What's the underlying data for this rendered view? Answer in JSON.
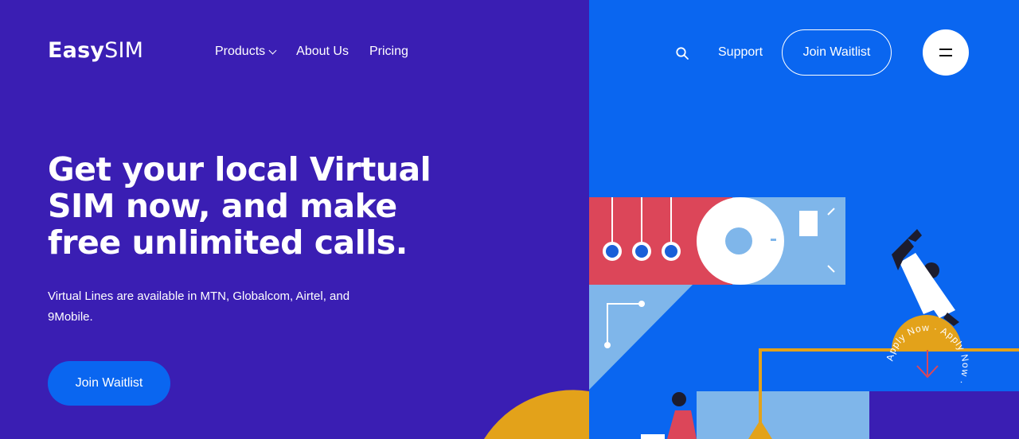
{
  "brand": {
    "name_bold": "Easy",
    "name_light": "SIM"
  },
  "nav": {
    "products": "Products",
    "about": "About Us",
    "pricing": "Pricing"
  },
  "header_right": {
    "search_icon": "search-icon",
    "support": "Support",
    "join_waitlist": "Join Waitlist",
    "menu_icon": "hamburger-menu-icon"
  },
  "hero": {
    "headline": "Get your local Virtual SIM now, and make free unlimited calls.",
    "subtext": "Virtual Lines are available in MTN, Globalcom, Airtel, and 9Mobile.",
    "cta": "Join Waitlist"
  },
  "badge": {
    "text": "Apply Now · Apply Now · "
  },
  "colors": {
    "left_bg": "#3a1eb3",
    "right_bg": "#0a66f0",
    "accent_red": "#dc4659",
    "accent_yellow": "#e3a21a",
    "light_blue": "#7fb6ea"
  }
}
